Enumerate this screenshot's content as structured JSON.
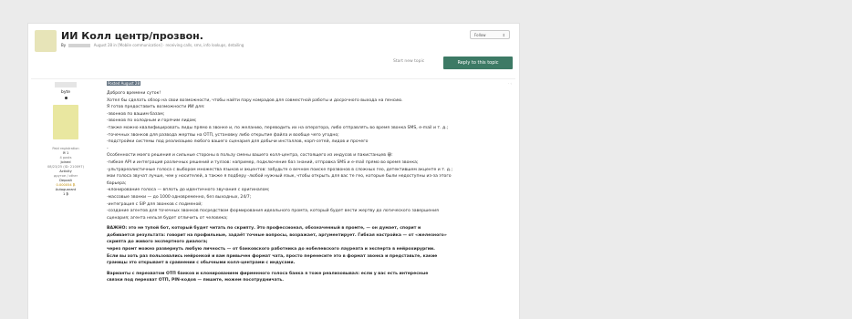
{
  "topic": {
    "title": "ИИ Колл центр/прозвон.",
    "by_label": "By",
    "date_forum": "August 28 in [Mobile communication]",
    "tags": "· receiving calls, sms, info lookups, detailing",
    "follow_label": "Follow",
    "follow_icon": "chevron-updown-icon"
  },
  "actions": {
    "start_new_topic": "Start new topic",
    "reply_label": "Reply to this topic",
    "reply_color": "#3d7a65"
  },
  "author": {
    "name": "byte",
    "group": "Paid registration",
    "posts_icon": "message-icon",
    "posts_count": "1",
    "posts": "4 posts",
    "joined_label": "Joined",
    "joined": "08/23/25 (ID: 210097)",
    "activity_label": "Activity",
    "activity": "другое / other",
    "deposit_label": "Deposit",
    "deposit": "0.000054 ₿",
    "autoguarant_label": "Autoguarant",
    "autoguarant": "1 ₿"
  },
  "post": {
    "date": "Posted August 28",
    "corner": "· ‹",
    "lines": [
      "Доброго времени суток!",
      "Хотел бы сделать обзор на свои возможности, чтобы найти пару комрадов для совместной работы и досрочного выхода на пенсию.",
      "Я готов предоставить возможности ИИ для:",
      "-звонков по вашим базам;",
      "-звонков по холодным и горячим лидам;",
      "-также можно квалифицировать лиды прямо в звонке и, по желанию, переводить их на оператора, либо отправлять во время звонка SMS, e-mail и т. д.;",
      "-точечных звонков для развода жертвы на ОТП, установку либо открытие файла и вообще чего угодно;",
      "-подстройки системы под реализацию любого вашего сценария для добычи инсталлов, корп-сетей, лидов и прочего",
      "-",
      "Особенности моего решения и сильные стороны в пользу смены вашего колл-центра, состоящего из индусов и пакистанцев 😀:",
      "-гибкое API и интеграция различных решений и тулзов: например, подключение баз знаний, отправка SMS и e-mail прямо во время звонка;",
      "-ультрареалистичные голоса с выбором множества языков и акцентов: забудьте о вечном поиске прозвонов в сложных гео, детектившем акценте и т. д.;",
      "мои голоса звучат лучше, чем у носителей, а также я подберу -любой нужный язык, чтобы открыть для вас те гео, которые были недоступны из-за этого",
      "барьера;",
      "-клонирование голоса — вплоть до идентичного звучания с оригиналом;",
      "-массовые звонки — до 1000 одновременно, без выходных, 24/7;",
      "-интеграция с SIP для звонков с подменой;",
      "-создание агентов для точечных звонков посредством формирования идеального промта, который будет вести жертву до логического завершения",
      "сценария; агента нельзя будет отличить от человека;"
    ],
    "bold_lines": [
      "ВАЖНО: это не тупой бот, который будет читать по скрипту. Это профессионал, обозначенный в промте, — он думает, спорит и",
      "добивается результата: говорит на профильные, задаёт точные вопросы, возражает, аргументирует. Гибкая настройка — от «железного»",
      "скрипта до живого экспертного диалога;",
      "через промт можно развернуть любую личность — от банковского работника до нобелевского лауреата и эксперта в нейрохирургии.",
      "Если вы хоть раз пользовались нейронкой и вам привычен формат чата, просто перенесите это в формат звонка и представьте, какие",
      "границы это открывает в сравнении с обычными колл-центрами с индусами."
    ],
    "closing_lines": [
      "Варианты с перехватом ОТП банков и клонированием фирменного голоса банка я тоже реализовывал: если у вас есть интересные",
      "связки под перехват ОТП, PIN-кодов — пишите, можем посотрудничать."
    ]
  }
}
